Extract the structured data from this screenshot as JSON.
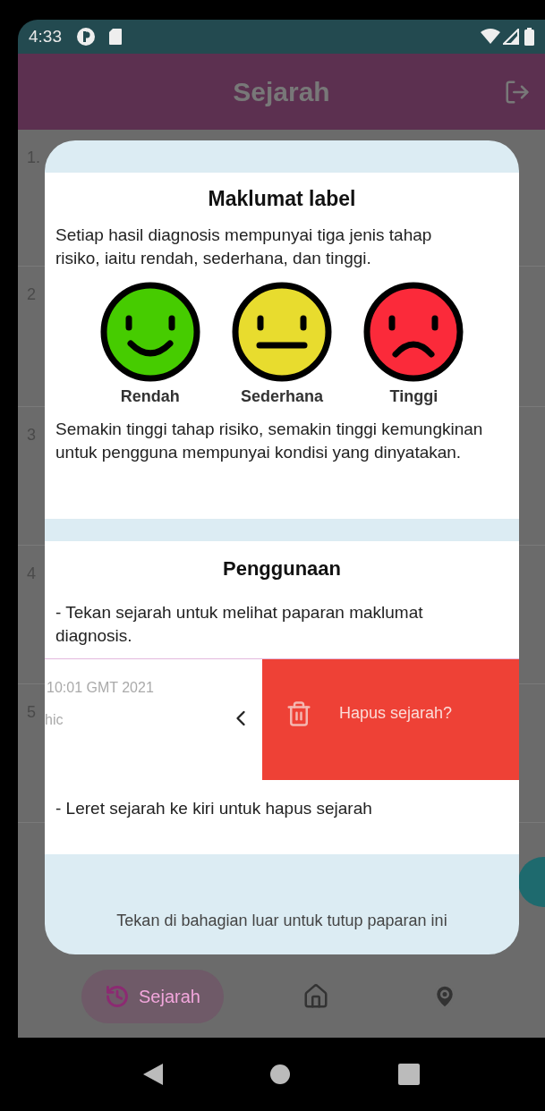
{
  "status_bar": {
    "time": "4:33"
  },
  "app_bar": {
    "title": "Sejarah"
  },
  "list_numbers": [
    "1.",
    "2",
    "3",
    "4",
    "5"
  ],
  "dialog": {
    "label_section": {
      "title": "Maklumat label",
      "intro": "Setiap hasil diagnosis mempunyai tiga jenis tahap risiko, iaitu rendah, sederhana, dan tinggi.",
      "levels": [
        {
          "label": "Rendah",
          "kind": "happy",
          "color": "#46cc00"
        },
        {
          "label": "Sederhana",
          "kind": "neutral",
          "color": "#e8dc2e"
        },
        {
          "label": "Tinggi",
          "kind": "sad",
          "color": "#fb2a3a"
        }
      ],
      "note": "Semakin tinggi tahap risiko, semakin tinggi kemungkinan untuk pengguna mempunyai kondisi yang dinyatakan."
    },
    "usage_section": {
      "title": "Penggunaan",
      "tap_hint": "- Tekan sejarah untuk melihat paparan maklumat diagnosis.",
      "swipe_demo": {
        "date": "10:01 GMT 2021",
        "subtitle": "hic",
        "action": "Hapus sejarah?"
      },
      "swipe_hint": "- Leret sejarah ke kiri untuk hapus sejarah"
    },
    "footer": "Tekan di bahagian luar untuk tutup paparan ini"
  },
  "bottom_nav": [
    {
      "kind": "history",
      "label": "Sejarah",
      "selected": true
    },
    {
      "kind": "home",
      "selected": false
    },
    {
      "kind": "location",
      "selected": false
    }
  ]
}
